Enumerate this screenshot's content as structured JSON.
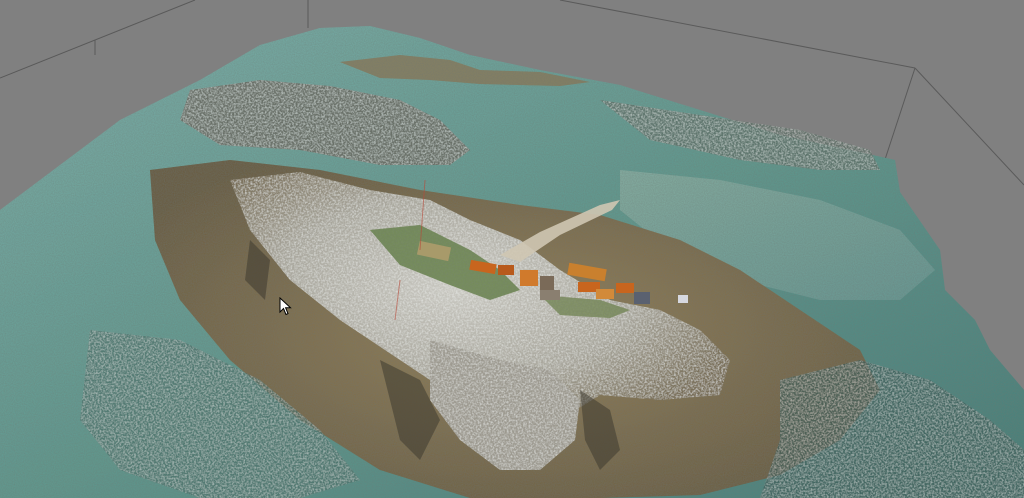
{
  "viewport": {
    "background_color": "#808080",
    "bounding_box_line_color": "#5a5a5a",
    "model": "photogrammetry-point-cloud-rocky-island"
  },
  "colors": {
    "water_shallow": "#5f9c92",
    "water_deep": "#3f7f7a",
    "seaweed_rock": "#8a7550",
    "bare_rock": "#b8b6ae",
    "vegetation": "#6e8a4a",
    "roof_orange": "#c8651e",
    "roof_slate": "#5a6170",
    "path": "#cfc6b2"
  },
  "cursor": {
    "icon": "mouse-pointer-icon"
  }
}
